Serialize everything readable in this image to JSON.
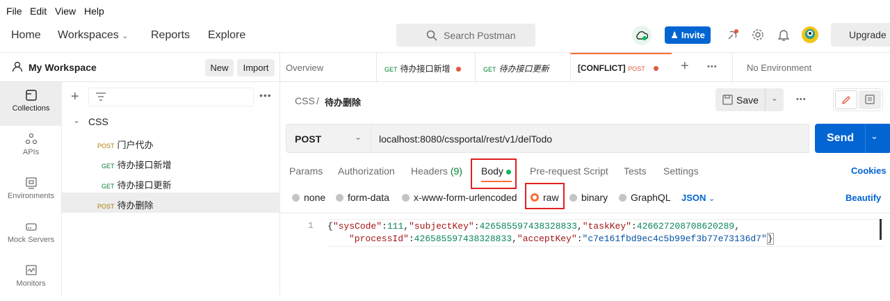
{
  "menubar": [
    "File",
    "Edit",
    "View",
    "Help"
  ],
  "header": {
    "nav": [
      "Home",
      "Workspaces",
      "Reports",
      "Explore"
    ],
    "search_placeholder": "Search Postman",
    "invite_label": "Invite",
    "upgrade_label": "Upgrade"
  },
  "workspace": {
    "name": "My Workspace",
    "new_label": "New",
    "import_label": "Import"
  },
  "rail": [
    "Collections",
    "APIs",
    "Environments",
    "Mock Servers",
    "Monitors"
  ],
  "tree": {
    "collection": "CSS",
    "items": [
      {
        "method": "POST",
        "name": "门户代办"
      },
      {
        "method": "GET",
        "name": "待办接口新增"
      },
      {
        "method": "GET",
        "name": "待办接口更新"
      },
      {
        "method": "POST",
        "name": "待办删除"
      }
    ]
  },
  "tabs": {
    "overview": "Overview",
    "t1_method": "GET",
    "t1_name": "待办接口新增",
    "t2_method": "GET",
    "t2_name": "待办接口更新",
    "t3_conflict": "[CONFLICT]",
    "t3_method": "POST",
    "environment": "No Environment"
  },
  "request": {
    "crumb_parent": "CSS",
    "crumb_name": "待办删除",
    "save_label": "Save",
    "method": "POST",
    "url": "localhost:8080/cssportal/rest/v1/delTodo",
    "send_label": "Send"
  },
  "param_tabs": {
    "params": "Params",
    "authorization": "Authorization",
    "headers": "Headers",
    "headers_count": "(9)",
    "body": "Body",
    "prerequest": "Pre-request Script",
    "tests": "Tests",
    "settings": "Settings",
    "cookies": "Cookies"
  },
  "body_types": {
    "none": "none",
    "form_data": "form-data",
    "urlencoded": "x-www-form-urlencoded",
    "raw": "raw",
    "binary": "binary",
    "graphql": "GraphQL",
    "format": "JSON",
    "beautify": "Beautify"
  },
  "editor": {
    "line_number": "1",
    "k1": "\"sysCode\"",
    "v1": "111",
    "k2": "\"subjectKey\"",
    "v2": "426585597438328833",
    "k3": "\"taskKey\"",
    "v3": "426627208708620289",
    "k4": "\"processId\"",
    "v4": "426585597438328833",
    "k5": "\"acceptKey\"",
    "v5": "\"c7e161fbd9ec4c5b99ef3b77e73136d7\""
  },
  "colors": {
    "accent": "#0265d2",
    "active_tab": "#ff6c37",
    "highlight_box": "#e02020",
    "post": "#ad7a03",
    "get": "#007f31"
  }
}
